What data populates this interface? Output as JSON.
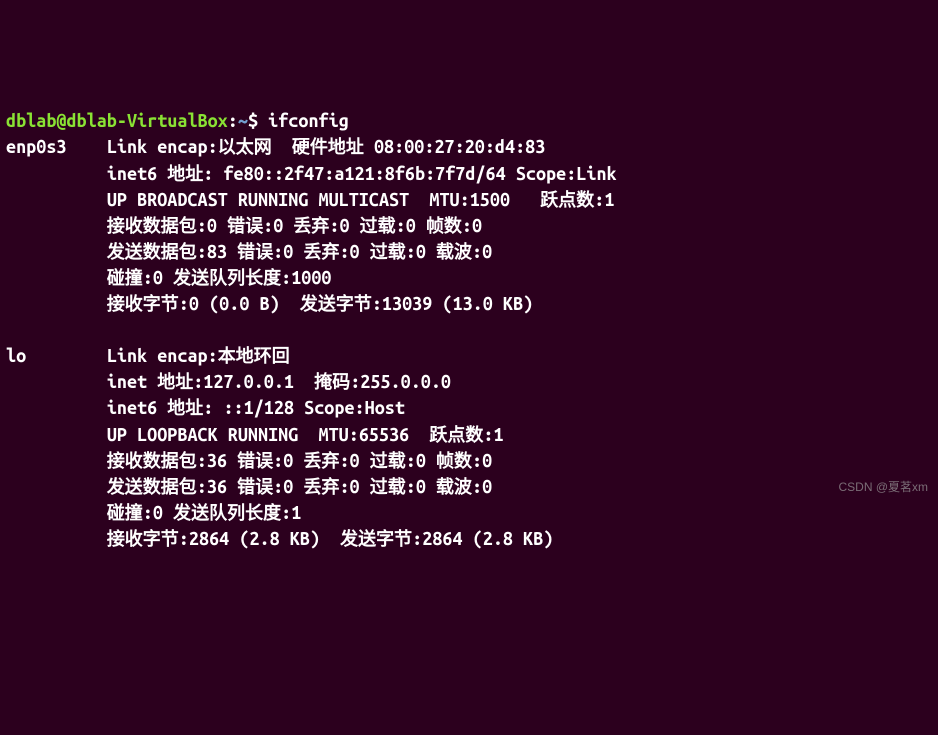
{
  "prompt": {
    "user_host": "dblab@dblab-VirtualBox",
    "separator": ":",
    "path": "~",
    "dollar": "$"
  },
  "command": "ifconfig",
  "interfaces": [
    {
      "name": "enp0s3",
      "link_encap_label": "Link encap:",
      "link_encap_value": "以太网",
      "hw_label": "硬件地址",
      "hw_value": "08:00:27:20:d4:83",
      "inet6_label": "inet6 地址:",
      "inet6_value": "fe80::2f47:a121:8f6b:7f7d/64",
      "scope_label": "Scope:",
      "scope_value": "Link",
      "flags": "UP BROADCAST RUNNING MULTICAST",
      "mtu_label": "MTU:",
      "mtu_value": "1500",
      "metric_label": "跃点数:",
      "metric_value": "1",
      "rx_packets_label": "接收数据包:",
      "rx_packets": "0",
      "err_label": "错误:",
      "rx_err": "0",
      "drop_label": "丢弃:",
      "rx_drop": "0",
      "over_label": "过载:",
      "rx_over": "0",
      "frame_label": "帧数:",
      "rx_frame": "0",
      "tx_packets_label": "发送数据包:",
      "tx_packets": "83",
      "tx_err": "0",
      "tx_drop": "0",
      "tx_over": "0",
      "carrier_label": "载波:",
      "tx_carrier": "0",
      "coll_label": "碰撞:",
      "coll": "0",
      "txq_label": "发送队列长度:",
      "txq": "1000",
      "rx_bytes_label": "接收字节:",
      "rx_bytes": "0",
      "rx_bytes_h": "(0.0 B)",
      "tx_bytes_label": "发送字节:",
      "tx_bytes": "13039",
      "tx_bytes_h": "(13.0 KB)"
    },
    {
      "name": "lo",
      "link_encap_label": "Link encap:",
      "link_encap_value": "本地环回",
      "inet_label": "inet 地址:",
      "inet_value": "127.0.0.1",
      "mask_label": "掩码:",
      "mask_value": "255.0.0.0",
      "inet6_label": "inet6 地址:",
      "inet6_value": "::1/128",
      "scope_label": "Scope:",
      "scope_value": "Host",
      "flags": "UP LOOPBACK RUNNING",
      "mtu_label": "MTU:",
      "mtu_value": "65536",
      "metric_label": "跃点数:",
      "metric_value": "1",
      "rx_packets_label": "接收数据包:",
      "rx_packets": "36",
      "err_label": "错误:",
      "rx_err": "0",
      "drop_label": "丢弃:",
      "rx_drop": "0",
      "over_label": "过载:",
      "rx_over": "0",
      "frame_label": "帧数:",
      "rx_frame": "0",
      "tx_packets_label": "发送数据包:",
      "tx_packets": "36",
      "tx_err": "0",
      "tx_drop": "0",
      "tx_over": "0",
      "carrier_label": "载波:",
      "tx_carrier": "0",
      "coll_label": "碰撞:",
      "coll": "0",
      "txq_label": "发送队列长度:",
      "txq": "1",
      "rx_bytes_label": "接收字节:",
      "rx_bytes": "2864",
      "rx_bytes_h": "(2.8 KB)",
      "tx_bytes_label": "发送字节:",
      "tx_bytes": "2864",
      "tx_bytes_h": "(2.8 KB)"
    }
  ],
  "watermark": "CSDN @夏茗xm"
}
